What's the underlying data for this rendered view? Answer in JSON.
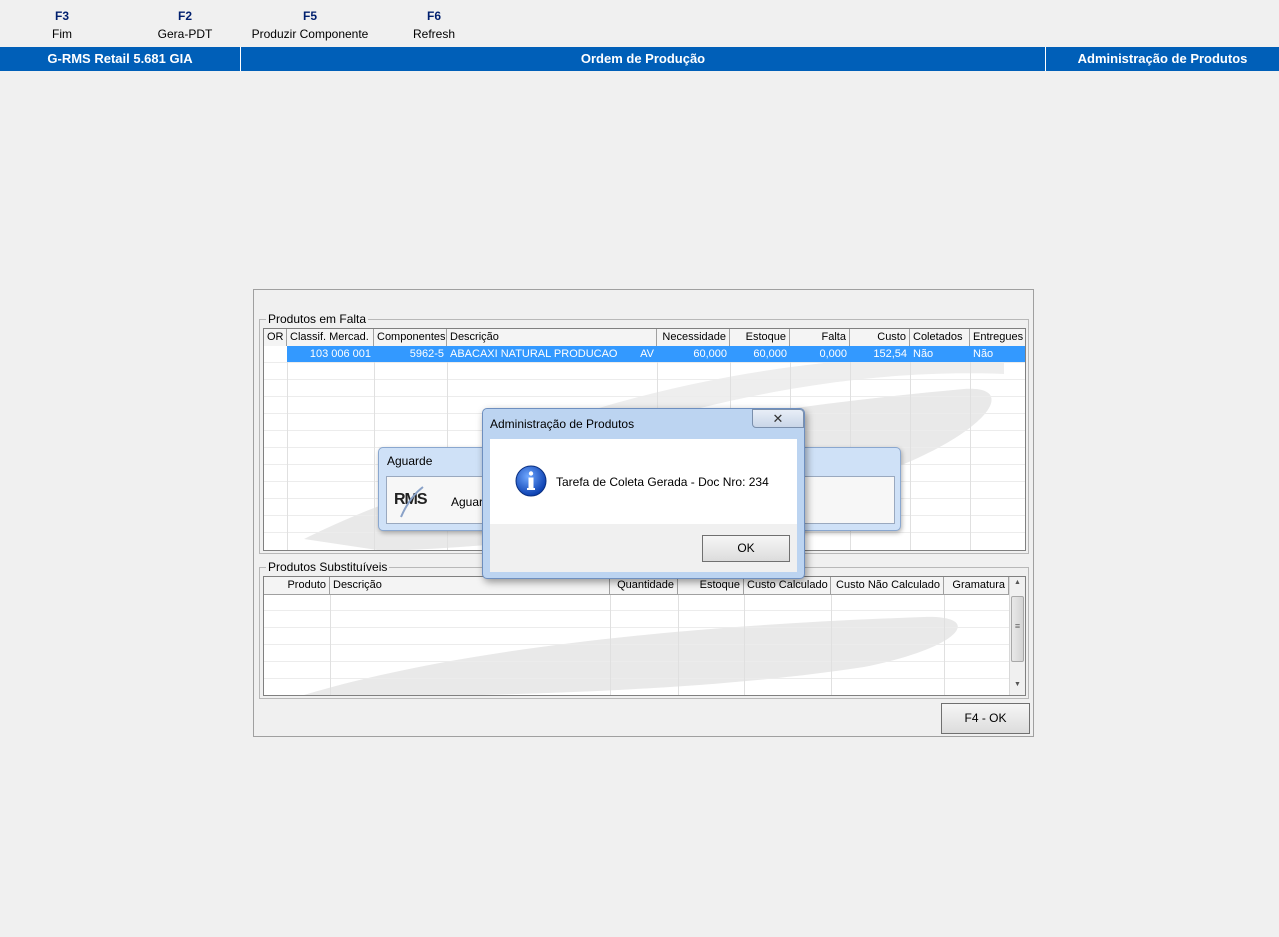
{
  "toolbar": {
    "keys": [
      {
        "key": "F3",
        "label": "Fim"
      },
      {
        "key": "F2",
        "label": "Gera-PDT"
      },
      {
        "key": "F5",
        "label": "Produzir Componente"
      },
      {
        "key": "F6",
        "label": "Refresh"
      }
    ]
  },
  "titlebar": {
    "app": "G-RMS Retail 5.681 GIA",
    "screen": "Ordem de Produção",
    "module": "Administração de Produtos"
  },
  "faltas": {
    "legend": "Produtos em Falta",
    "columns": [
      "OR",
      "Classif. Mercad.",
      "Componentes",
      "Descrição",
      "Necessidade",
      "Estoque",
      "Falta",
      "Custo",
      "Coletados",
      "Entregues"
    ],
    "rows": [
      {
        "or": "",
        "classif": "103  006  001",
        "componente": "5962-5",
        "descricao": "ABACAXI NATURAL PRODUCAO",
        "unidade": "AV",
        "necessidade": "60,000",
        "estoque": "60,000",
        "falta": "0,000",
        "custo": "152,54",
        "coletados": "Não",
        "entregues": "Não"
      }
    ]
  },
  "substituiveis": {
    "legend": "Produtos Substituíveis",
    "columns": [
      "Produto",
      "Descrição",
      "Quantidade",
      "Estoque",
      "Custo Calculado",
      "Custo Não Calculado",
      "Gramatura"
    ]
  },
  "ok_button": "F4 - OK",
  "aguarde": {
    "title": "Aguarde",
    "logo": "RMS",
    "message": "Aguard"
  },
  "dialog": {
    "title": "Administração de Produtos",
    "close": "✕",
    "message": "Tarefa de Coleta Gerada - Doc Nro: 234",
    "ok": "OK"
  },
  "scroll_arrows": {
    "up": "▲",
    "down": "▼",
    "grip": "≡"
  },
  "colors": {
    "titlebar": "#005fb8",
    "selection": "#3399ff",
    "fkey": "#001f6e"
  }
}
